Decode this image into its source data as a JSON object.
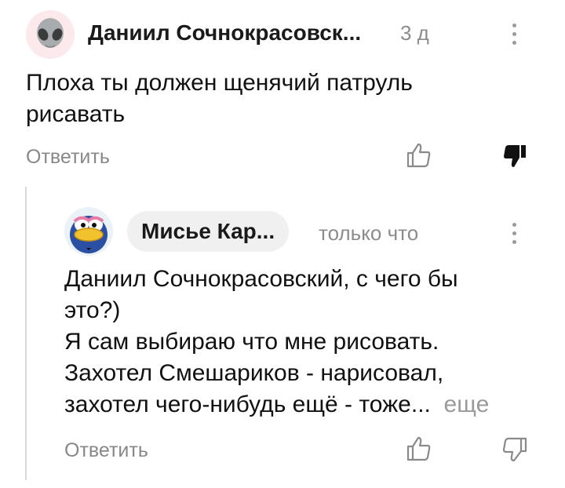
{
  "comment": {
    "author": "Даниил Сочнокрасовск...",
    "time": "3 д",
    "text_line1": "Плоха ты должен щенячий патруль",
    "text_line2": "рисавать",
    "reply_label": "Ответить"
  },
  "reply": {
    "author": "Мисье Кар...",
    "time": "только что",
    "lines": [
      "Даниил Сочнокрасовский, с чего бы",
      "это?)",
      "Я сам выбираю что мне рисовать.",
      "Захотел Смешариков - нарисовал,",
      "захотел чего-нибудь ещё - тоже..."
    ],
    "more_label": "еще",
    "reply_label": "Ответить"
  },
  "icons": {
    "alien_avatar": "alien-avatar-icon",
    "bird_avatar": "bird-avatar-icon",
    "like": "thumbs-up-icon",
    "dislike": "thumbs-down-icon",
    "menu": "kebab-menu-icon"
  },
  "colors": {
    "dislike_active": "#111111",
    "muted_text": "#888888",
    "thread_line": "#d9d9d9"
  }
}
